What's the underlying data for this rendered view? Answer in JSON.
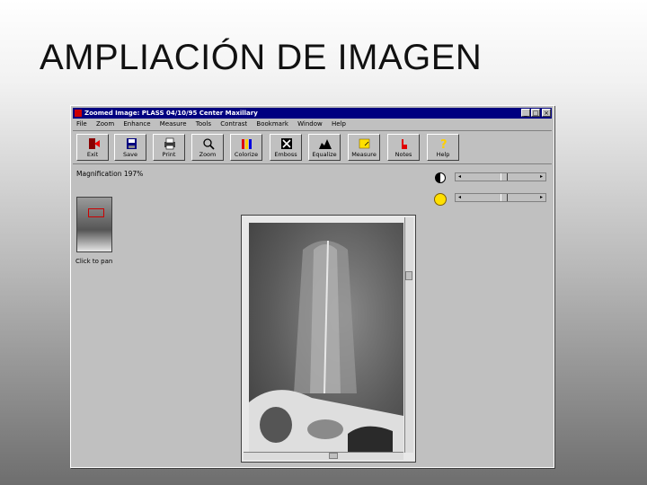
{
  "slide": {
    "title": "AMPLIACIÓN DE IMAGEN"
  },
  "window": {
    "title": "Zoomed Image: PLASS    04/10/95   Center Maxillary",
    "controls": [
      "_",
      "□",
      "×"
    ],
    "menu": [
      "File",
      "Zoom",
      "Enhance",
      "Measure",
      "Tools",
      "Contrast",
      "Bookmark",
      "Window",
      "Help"
    ]
  },
  "toolbar": {
    "buttons": [
      {
        "label": "Exit",
        "icon": "exit-icon"
      },
      {
        "label": "Save",
        "icon": "save-icon"
      },
      {
        "label": "Print",
        "icon": "print-icon"
      },
      {
        "label": "Zoom",
        "icon": "magnifier-icon"
      },
      {
        "label": "Colorize",
        "icon": "color-bars-icon"
      },
      {
        "label": "Emboss",
        "icon": "emboss-icon"
      },
      {
        "label": "Equalize",
        "icon": "histogram-icon"
      },
      {
        "label": "Measure",
        "icon": "measure-icon"
      },
      {
        "label": "Notes",
        "icon": "notes-icon"
      },
      {
        "label": "Help",
        "icon": "help-icon"
      }
    ]
  },
  "view": {
    "magnification": "Magnification 197%",
    "click_to_pan": "Click to pan",
    "contrast_level": 0.55,
    "brightness_level": 0.55
  },
  "colors": {
    "titlebar": "#000080",
    "window_face": "#c0c0c0"
  }
}
